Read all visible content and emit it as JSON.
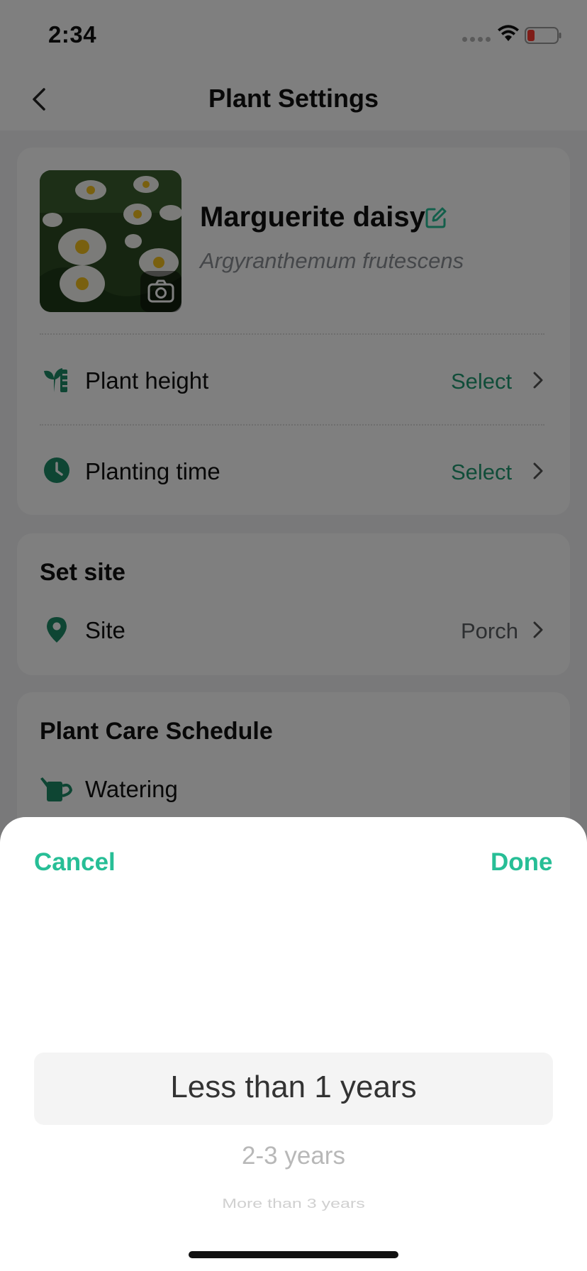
{
  "status_bar": {
    "time": "2:34"
  },
  "header": {
    "title": "Plant Settings"
  },
  "plant": {
    "name": "Marguerite daisy",
    "latin_name": "Argyranthemum frutescens"
  },
  "details": {
    "height": {
      "label": "Plant height",
      "value": "Select"
    },
    "planting_time": {
      "label": "Planting time",
      "value": "Select"
    }
  },
  "site_section": {
    "title": "Set site",
    "site": {
      "label": "Site",
      "value": "Porch"
    }
  },
  "care_section": {
    "title": "Plant Care Schedule",
    "watering": {
      "label": "Watering"
    }
  },
  "sheet": {
    "cancel": "Cancel",
    "done": "Done",
    "options": [
      "Less than 1 years",
      "2-3 years",
      "More than 3 years"
    ],
    "selected_index": 0
  },
  "colors": {
    "accent": "#27be96",
    "icon_green": "#1c8a66",
    "value_green": "#219a72"
  }
}
